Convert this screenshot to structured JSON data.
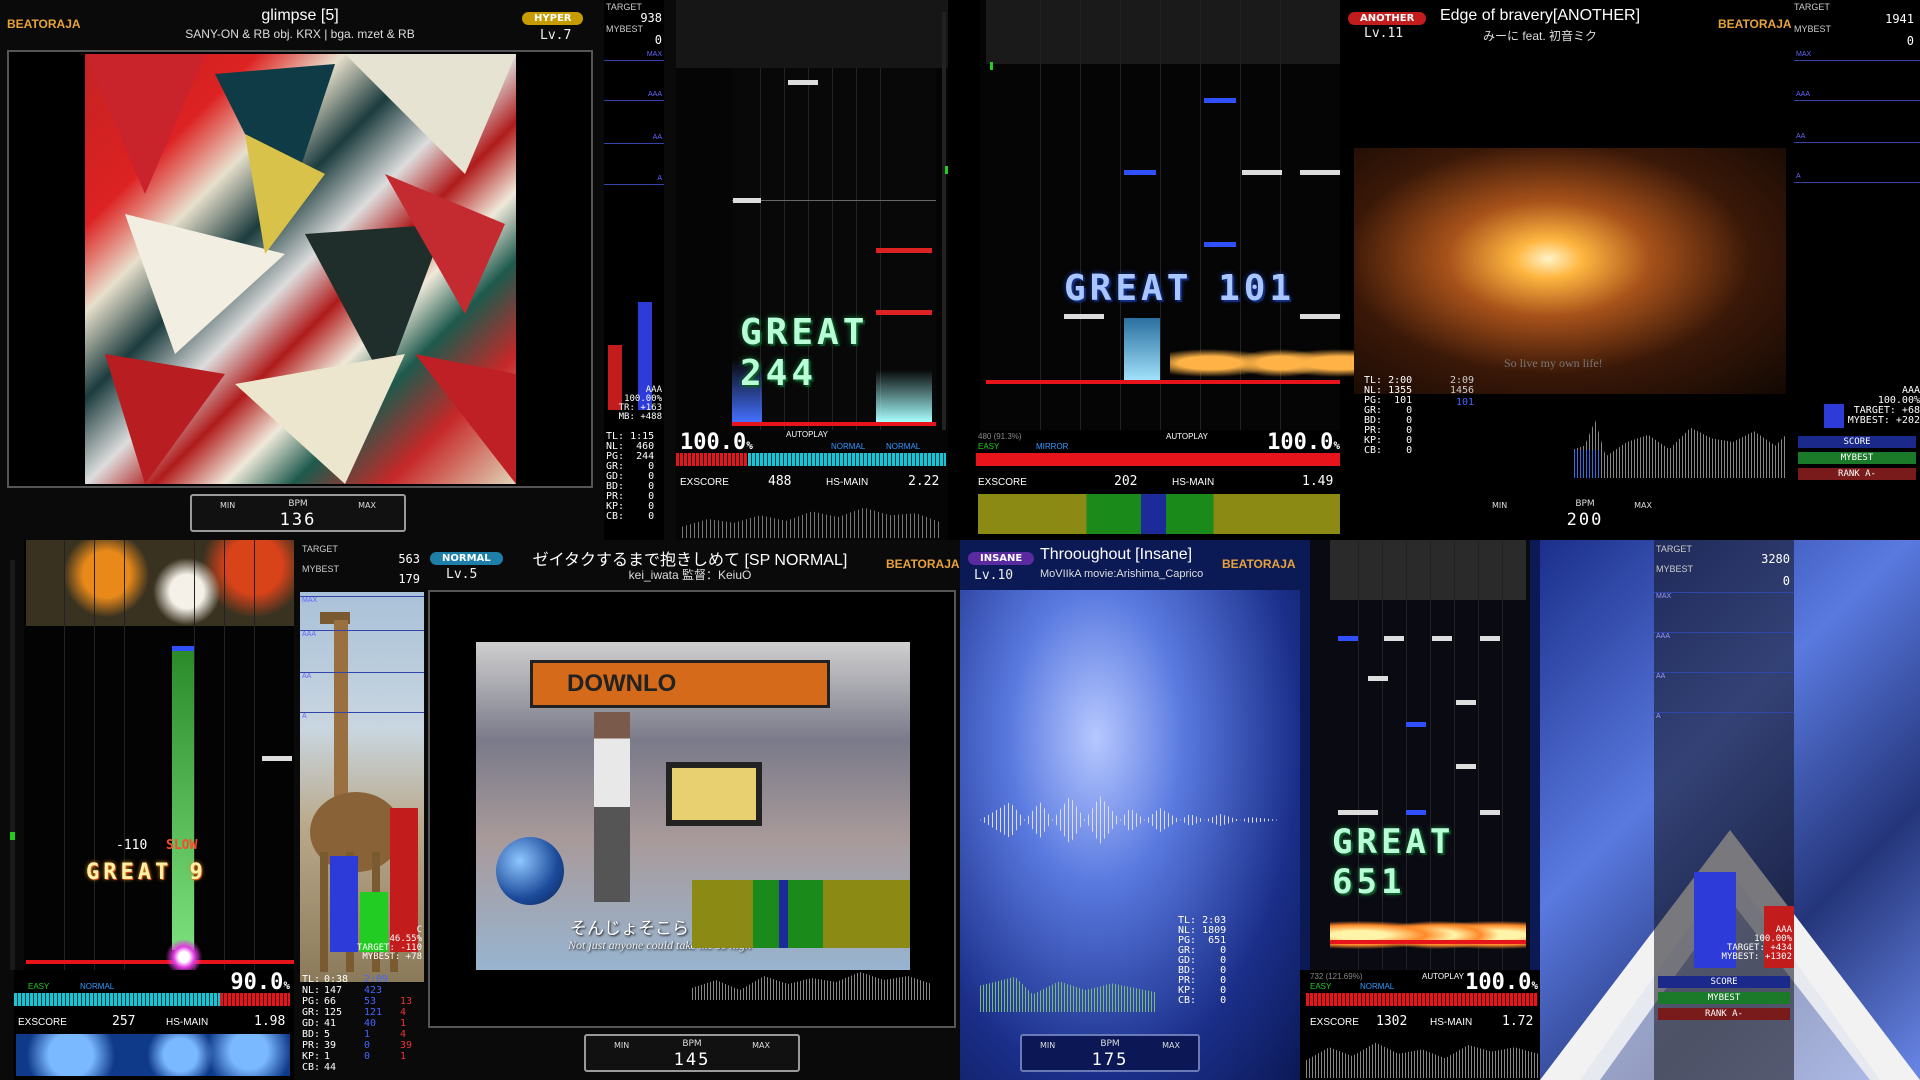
{
  "panels": {
    "p1": {
      "logo": "BEATORAJA",
      "difficulty": "HYPER",
      "title": "glimpse [5]",
      "artist": "SANY-ON & RB obj. KRX | bga. mzet & RB",
      "level": "Lv.7",
      "target_label": "TARGET",
      "target_value": "938",
      "mybest_label": "MYBEST",
      "mybest_value": "0",
      "grade_marks": [
        "MAX",
        "AAA",
        "AA",
        "A"
      ],
      "rank_summary": [
        "AAA",
        "100.00%",
        "TR: +163",
        "MB: +488"
      ],
      "judge_text": "GREAT",
      "combo": "244",
      "percent": "100.0",
      "percent_unit": "%",
      "autoplay": "AUTOPLAY",
      "mode1": "NORMAL",
      "mode2": "NORMAL",
      "exscore_label": "EXSCORE",
      "exscore": "488",
      "hs_label": "HS-MAIN",
      "hs": "2.22",
      "stats": [
        "TL: 1:15",
        "NL:  460",
        "PG:  244",
        "GR:    0",
        "GD:    0",
        "BD:    0",
        "PR:    0",
        "KP:    0",
        "CB:    0"
      ],
      "bpm_min": "MIN",
      "bpm_label": "BPM",
      "bpm_max": "MAX",
      "bpm": "136"
    },
    "p2": {
      "logo": "BEATORAJA",
      "difficulty": "ANOTHER",
      "title": "Edge of bravery[ANOTHER]",
      "artist": "みーに feat. 初音ミク",
      "level": "Lv.11",
      "target_label": "TARGET",
      "target_value": "1941",
      "mybest_label": "MYBEST",
      "mybest_value": "0",
      "grade_marks": [
        "MAX",
        "AAA",
        "AA",
        "A"
      ],
      "judge_text": "GREAT",
      "combo": "101",
      "bga_caption": "So live my own life!",
      "gauge_info": "480 (91.3%)",
      "mode1": "EASY",
      "mode2": "MIRROR",
      "autoplay": "AUTOPLAY",
      "percent": "100.0",
      "percent_unit": "%",
      "exscore_label": "EXSCORE",
      "exscore": "202",
      "hs_label": "HS-MAIN",
      "hs": "1.49",
      "stats_left": [
        "TL: 2:00",
        "NL: 1355",
        "PG:  101",
        "GR:    0",
        "BD:    0",
        "PR:    0",
        "KP:    0",
        "CB:    0"
      ],
      "stats_total": "2:09",
      "stats_nl_total": "1456",
      "stats_pg_blue": "101",
      "rank_summary": [
        "AAA",
        "100.00%",
        "TARGET: +68",
        "MYBEST: +202"
      ],
      "buttons": [
        "SCORE",
        "MYBEST",
        "RANK A-"
      ],
      "bpm_min": "MIN",
      "bpm_label": "BPM",
      "bpm_max": "MAX",
      "bpm": "200"
    },
    "p3": {
      "logo": "BEATORAJA",
      "difficulty": "NORMAL",
      "title": "ゼイタクするまで抱きしめて [SP NORMAL]",
      "artist": "kei_iwata 監督：KeiuO",
      "level": "Lv.5",
      "target_label": "TARGET",
      "target_value": "563",
      "mybest_label": "MYBEST",
      "mybest_value": "179",
      "grade_marks": [
        "MAX",
        "AAA",
        "AA",
        "A"
      ],
      "timing": "-110",
      "slow": "SLOW",
      "judge_text": "GREAT",
      "combo": "9",
      "rank_summary": [
        "C",
        "46.55%",
        "TARGET: -110",
        "MYBEST: +78"
      ],
      "mode1": "EASY",
      "mode2": "NORMAL",
      "percent": "90.0",
      "percent_unit": "%",
      "exscore_label": "EXSCORE",
      "exscore": "257",
      "hs_label": "HS-MAIN",
      "hs": "1.98",
      "stats_rows": [
        {
          "k": "TL:",
          "a": "0:38",
          "b": "2:09",
          "c": ""
        },
        {
          "k": "NL:",
          "a": "147",
          "b": "423",
          "c": ""
        },
        {
          "k": "PG:",
          "a": "66",
          "b": "53",
          "c": "13"
        },
        {
          "k": "GR:",
          "a": "125",
          "b": "121",
          "c": "4"
        },
        {
          "k": "GD:",
          "a": "41",
          "b": "40",
          "c": "1"
        },
        {
          "k": "BD:",
          "a": "5",
          "b": "1",
          "c": "4"
        },
        {
          "k": "PR:",
          "a": "39",
          "b": "0",
          "c": "39"
        },
        {
          "k": "KP:",
          "a": "1",
          "b": "0",
          "c": "1"
        },
        {
          "k": "CB:",
          "a": "44",
          "b": "",
          "c": ""
        }
      ],
      "bga_sign": "DOWNLO",
      "subtitle_jp": "そんじょそこらし",
      "subtitle_en": "Not just anyone could take me so high",
      "bpm_min": "MIN",
      "bpm_label": "BPM",
      "bpm_max": "MAX",
      "bpm": "145"
    },
    "p4": {
      "logo": "BEATORAJA",
      "difficulty": "INSANE",
      "title": "Throoughout [Insane]",
      "artist": "MoVIIkA movie:Arishima_Caprico",
      "level": "Lv.10",
      "target_label": "TARGET",
      "target_value": "3280",
      "mybest_label": "MYBEST",
      "mybest_value": "0",
      "grade_marks": [
        "MAX",
        "AAA",
        "AA",
        "A"
      ],
      "judge_text": "GREAT",
      "combo": "651",
      "stats": [
        "TL: 2:03",
        "NL: 1809",
        "PG:  651",
        "GR:    0",
        "GD:    0",
        "BD:    0",
        "PR:    0",
        "KP:    0",
        "CB:    0"
      ],
      "gauge_info": "732 (121.69%)",
      "mode1": "EASY",
      "mode2": "NORMAL",
      "autoplay": "AUTOPLAY",
      "percent": "100.0",
      "percent_unit": "%",
      "exscore_label": "EXSCORE",
      "exscore": "1302",
      "hs_label": "HS-MAIN",
      "hs": "1.72",
      "rank_summary": [
        "AAA",
        "100.00%",
        "TARGET: +434",
        "MYBEST: +1302"
      ],
      "buttons": [
        "SCORE",
        "MYBEST",
        "RANK A-"
      ],
      "bpm_min": "MIN",
      "bpm_label": "BPM",
      "bpm_max": "MAX",
      "bpm": "175"
    }
  },
  "colors": {
    "hyper": "#c79c00",
    "another": "#c21c1c",
    "normal": "#1e7fa8",
    "insane": "#5a2ba0",
    "logo": "#e8a23a",
    "great_green": "#b8ffd8",
    "gauge_cyan": "#17c7d3",
    "gauge_red": "#e8141c"
  }
}
